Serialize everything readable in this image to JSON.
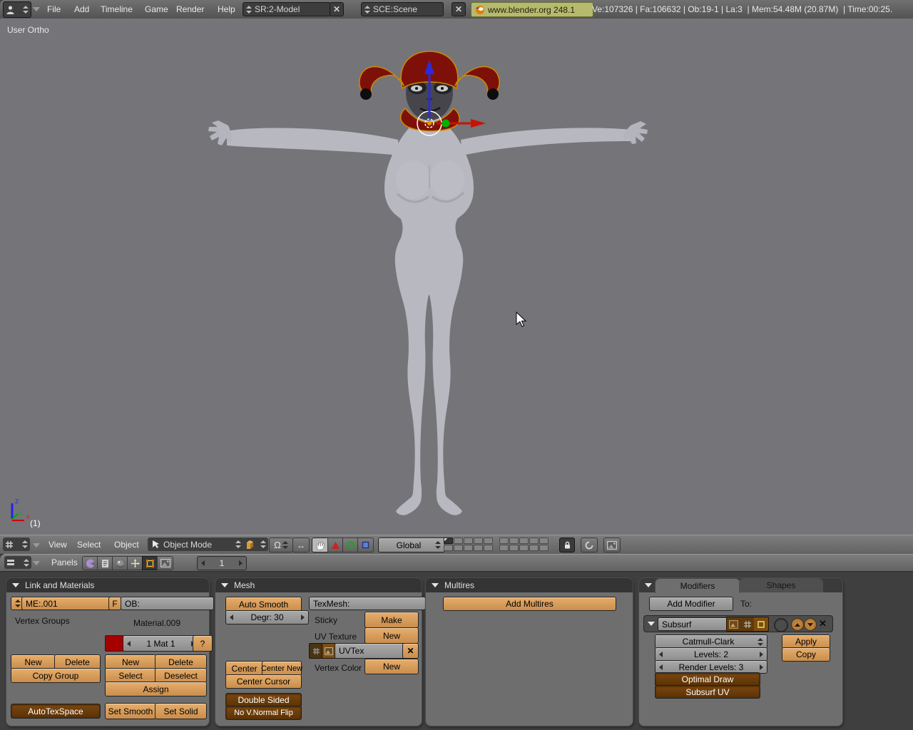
{
  "topbar": {
    "menus": [
      "File",
      "Add",
      "Timeline",
      "Game",
      "Render",
      "Help"
    ],
    "screen_selector": "SR:2-Model",
    "scene_selector": "SCE:Scene",
    "version_badge": "www.blender.org 248.1",
    "stats": "Ve:107326 | Fa:106632 | Ob:19-1 | La:3  | Mem:54.48M (20.87M)  | Time:00:25."
  },
  "viewport": {
    "view_label": "User Ortho",
    "layer_indicator": "(1)",
    "axis_x": "x",
    "axis_y": "y",
    "axis_z": "z"
  },
  "viewport_header": {
    "menu_view": "View",
    "menu_select": "Select",
    "menu_object": "Object",
    "mode_selector": "Object Mode",
    "orientation_selector": "Global"
  },
  "buttons_header": {
    "panels_label": "Panels",
    "frame": "1"
  },
  "link_panel": {
    "title": "Link and Materials",
    "mesh_field": "ME:.001",
    "f_button": "F",
    "ob_field": "OB:",
    "vertex_groups_label": "Vertex Groups",
    "material_label": "Material.009",
    "mat_stepper": "1 Mat 1",
    "help_button": "?",
    "vg_new": "New",
    "vg_delete": "Delete",
    "vg_copy_group": "Copy Group",
    "mat_new": "New",
    "mat_delete": "Delete",
    "mat_select": "Select",
    "mat_deselect": "Deselect",
    "mat_assign": "Assign",
    "autotexspace": "AutoTexSpace",
    "set_smooth": "Set Smooth",
    "set_solid": "Set Solid"
  },
  "mesh_panel": {
    "title": "Mesh",
    "auto_smooth": "Auto Smooth",
    "degr": "Degr: 30",
    "texmesh": "TexMesh:",
    "sticky_label": "Sticky",
    "make_button": "Make",
    "uv_texture_label": "UV Texture",
    "uv_new": "New",
    "uvtex_field": "UVTex",
    "vertex_color_label": "Vertex Color",
    "vcol_new": "New",
    "center": "Center",
    "center_new": "Center New",
    "center_cursor": "Center Cursor",
    "double_sided": "Double Sided",
    "no_vnormal_flip": "No V.Normal Flip"
  },
  "multires_panel": {
    "title": "Multires",
    "add_multires": "Add Multires"
  },
  "modifiers_panel": {
    "tab_modifiers": "Modifiers",
    "tab_shapes": "Shapes",
    "add_modifier": "Add Modifier",
    "to_label": "To:",
    "modifier_name": "Subsurf",
    "subdiv_type": "Catmull-Clark",
    "levels": "Levels: 2",
    "render_levels": "Render Levels: 3",
    "optimal_draw": "Optimal Draw",
    "subsurf_uv": "Subsurf UV",
    "apply": "Apply",
    "copy": "Copy"
  },
  "icons": {
    "close": "✕",
    "pivot": "Ω",
    "manip_size": "↔"
  },
  "colors": {
    "accent_orange": "#D79B59",
    "pressed_brown": "#6E3D0E",
    "badge_olive": "#B6BA6F",
    "material_red": "#A40000",
    "selection_gold": "#C98A00",
    "viewport_gray": "#747479",
    "panel_gray": "#6E6E6E"
  }
}
